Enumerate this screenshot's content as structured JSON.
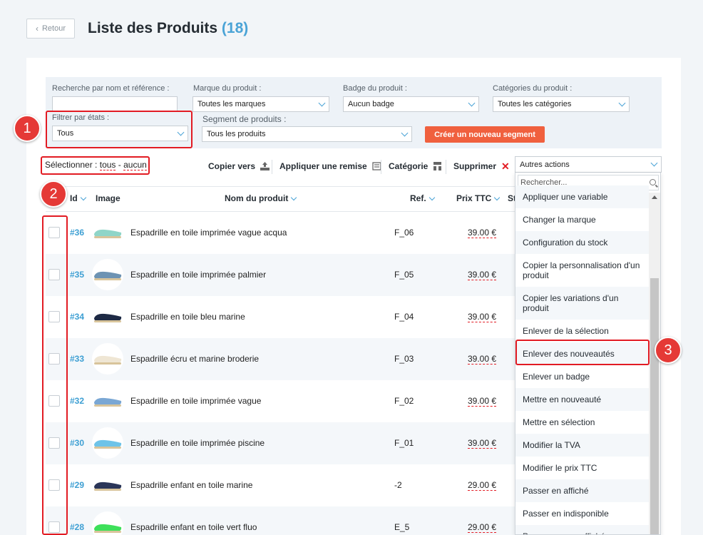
{
  "header": {
    "back_label": "Retour",
    "title": "Liste des Produits",
    "count": "(18)"
  },
  "filters": {
    "search": {
      "label": "Recherche par nom et référence :",
      "value": ""
    },
    "brand": {
      "label": "Marque du produit :",
      "value": "Toutes les marques"
    },
    "badge": {
      "label": "Badge du produit :",
      "value": "Aucun badge"
    },
    "category": {
      "label": "Catégories du produit :",
      "value": "Toutes les catégories"
    },
    "state": {
      "label": "Filtrer par états :",
      "value": "Tous"
    },
    "segment": {
      "label": "Segment de produits :",
      "value": "Tous les produits"
    },
    "create_segment": "Créer un nouveau segment"
  },
  "toolbar": {
    "select_label": "Sélectionner :",
    "select_all": "tous",
    "select_sep": "-",
    "select_none": "aucun",
    "copy": "Copier vers",
    "discount": "Appliquer une remise",
    "category": "Catégorie",
    "delete": "Supprimer",
    "actions": "Autres actions"
  },
  "table": {
    "headers": {
      "id": "Id",
      "image": "Image",
      "name": "Nom du produit",
      "ref": "Ref.",
      "price": "Prix TTC",
      "status": "St"
    },
    "rows": [
      {
        "id": "#36",
        "name": "Espadrille en toile imprimée vague acqua",
        "ref": "F_06",
        "price": "39.00 €"
      },
      {
        "id": "#35",
        "name": "Espadrille en toile imprimée palmier",
        "ref": "F_05",
        "price": "39.00 €"
      },
      {
        "id": "#34",
        "name": "Espadrille en toile bleu marine",
        "ref": "F_04",
        "price": "39.00 €"
      },
      {
        "id": "#33",
        "name": "Espadrille écru et marine broderie",
        "ref": "F_03",
        "price": "39.00 €"
      },
      {
        "id": "#32",
        "name": "Espadrille en toile imprimée vague",
        "ref": "F_02",
        "price": "39.00 €"
      },
      {
        "id": "#30",
        "name": "Espadrille en toile imprimée piscine",
        "ref": "F_01",
        "price": "39.00 €"
      },
      {
        "id": "#29",
        "name": "Espadrille enfant en toile marine",
        "ref": "-2",
        "price": "29.00 €"
      },
      {
        "id": "#28",
        "name": "Espadrille enfant en toile vert fluo",
        "ref": "E_5",
        "price": "29.00 €"
      }
    ]
  },
  "dropdown": {
    "search_placeholder": "Rechercher...",
    "items": [
      "Appliquer une variable",
      "Changer la marque",
      "Configuration du stock",
      "Copier la personnalisation d'un produit",
      "Copier les variations d'un produit",
      "Enlever de la sélection",
      "Enlever des nouveautés",
      "Enlever un badge",
      "Mettre en nouveauté",
      "Mettre en sélection",
      "Modifier la TVA",
      "Modifier le prix TTC",
      "Passer en affiché",
      "Passer en indisponible",
      "Passer en non affiché"
    ]
  },
  "annotations": [
    "1",
    "2",
    "3"
  ],
  "colors": {
    "accent": "#4aa3d6",
    "cta": "#f0603e",
    "annotation": "#e21b23"
  }
}
